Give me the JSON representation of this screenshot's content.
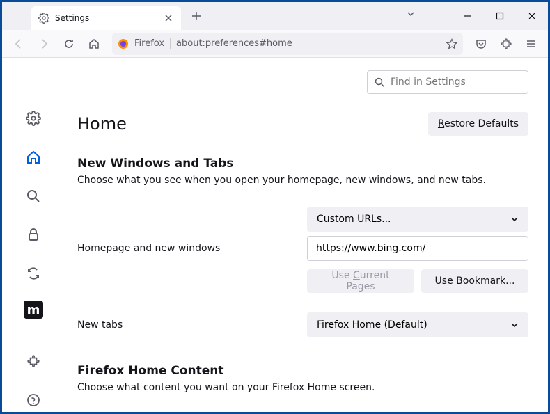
{
  "tab": {
    "title": "Settings"
  },
  "urlbar": {
    "identity": "Firefox",
    "path": "about:preferences#home"
  },
  "search": {
    "placeholder": "Find in Settings"
  },
  "page": {
    "title": "Home",
    "restore": "Restore Defaults"
  },
  "windows_tabs": {
    "heading": "New Windows and Tabs",
    "desc": "Choose what you see when you open your homepage, new windows, and new tabs.",
    "homepage_label": "Homepage and new windows",
    "homepage_select": "Custom URLs...",
    "homepage_url": "https://www.bing.com/",
    "use_current": "Use Current Pages",
    "use_bookmark": "Use Bookmark...",
    "newtabs_label": "New tabs",
    "newtabs_select": "Firefox Home (Default)"
  },
  "home_content": {
    "heading": "Firefox Home Content",
    "desc": "Choose what content you want on your Firefox Home screen."
  }
}
